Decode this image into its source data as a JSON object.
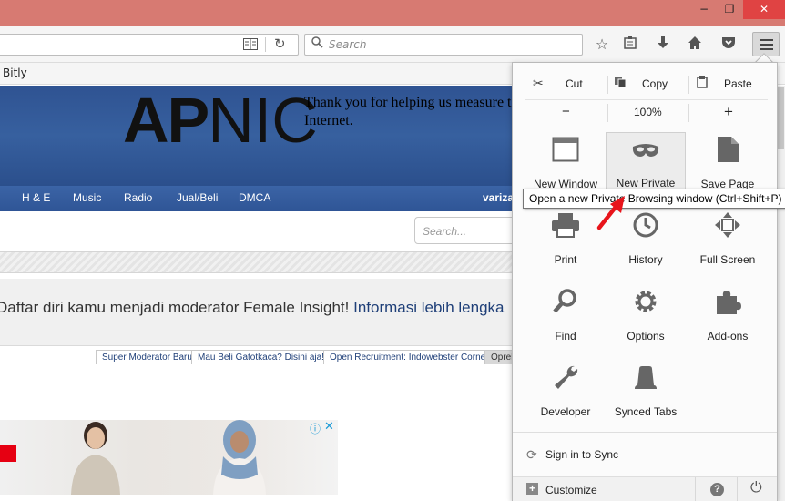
{
  "window": {
    "minimize_glyph": "−",
    "maximize_glyph": "❐",
    "close_glyph": "✕",
    "titlebar_color": "#d77a72"
  },
  "toolbar": {
    "search_placeholder": "Search",
    "icons": [
      "reader-view-icon",
      "reload-icon",
      "bookmark-star-icon",
      "bookmarks-list-icon",
      "download-icon",
      "home-icon",
      "pocket-icon",
      "hamburger-menu-icon"
    ]
  },
  "bookmarks": {
    "items": [
      {
        "label": "Bitly"
      }
    ]
  },
  "site": {
    "logo_bold": "AP",
    "logo_thin": "NIC",
    "header_text": "Thank you for helping us measure t Internet.",
    "nav": [
      "H & E",
      "Music",
      "Radio",
      "Jual/Beli",
      "DMCA"
    ],
    "user": "variza",
    "search_placeholder": "Search...",
    "notice_text": "Daftar diri kamu menjadi moderator Female Insight! ",
    "notice_link": "Informasi lebih lengka",
    "tabs": [
      "Super Moderator Baru",
      "Mau Beli Gatotkaca? Disini aja!!!",
      "Open Recruitment: Indowebster Corner",
      "Oprek"
    ],
    "ad_info": "ⓘ",
    "ad_close": "✕",
    "header_color": "#2f5392"
  },
  "menu": {
    "edit": {
      "cut": "Cut",
      "copy": "Copy",
      "paste": "Paste"
    },
    "zoom": {
      "minus": "−",
      "level": "100%",
      "plus": "+"
    },
    "items": [
      {
        "label": "New Window",
        "icon": "new-window-icon"
      },
      {
        "label": "New Private",
        "icon": "private-mask-icon"
      },
      {
        "label": "Save Page",
        "icon": "save-page-icon"
      },
      {
        "label": "Print",
        "icon": "printer-icon"
      },
      {
        "label": "History",
        "icon": "history-clock-icon"
      },
      {
        "label": "Full Screen",
        "icon": "fullscreen-icon"
      },
      {
        "label": "Find",
        "icon": "find-magnifier-icon"
      },
      {
        "label": "Options",
        "icon": "options-gear-icon"
      },
      {
        "label": "Add-ons",
        "icon": "addons-puzzle-icon"
      },
      {
        "label": "Developer",
        "icon": "developer-wrench-icon"
      },
      {
        "label": "Synced Tabs",
        "icon": "synced-tabs-icon"
      }
    ],
    "sync_label": "Sign in to Sync",
    "customize_label": "Customize",
    "help_glyph": "?",
    "quit_glyph": "⏻"
  },
  "tooltip": {
    "text": "Open a new Private Browsing window (Ctrl+Shift+P)"
  }
}
